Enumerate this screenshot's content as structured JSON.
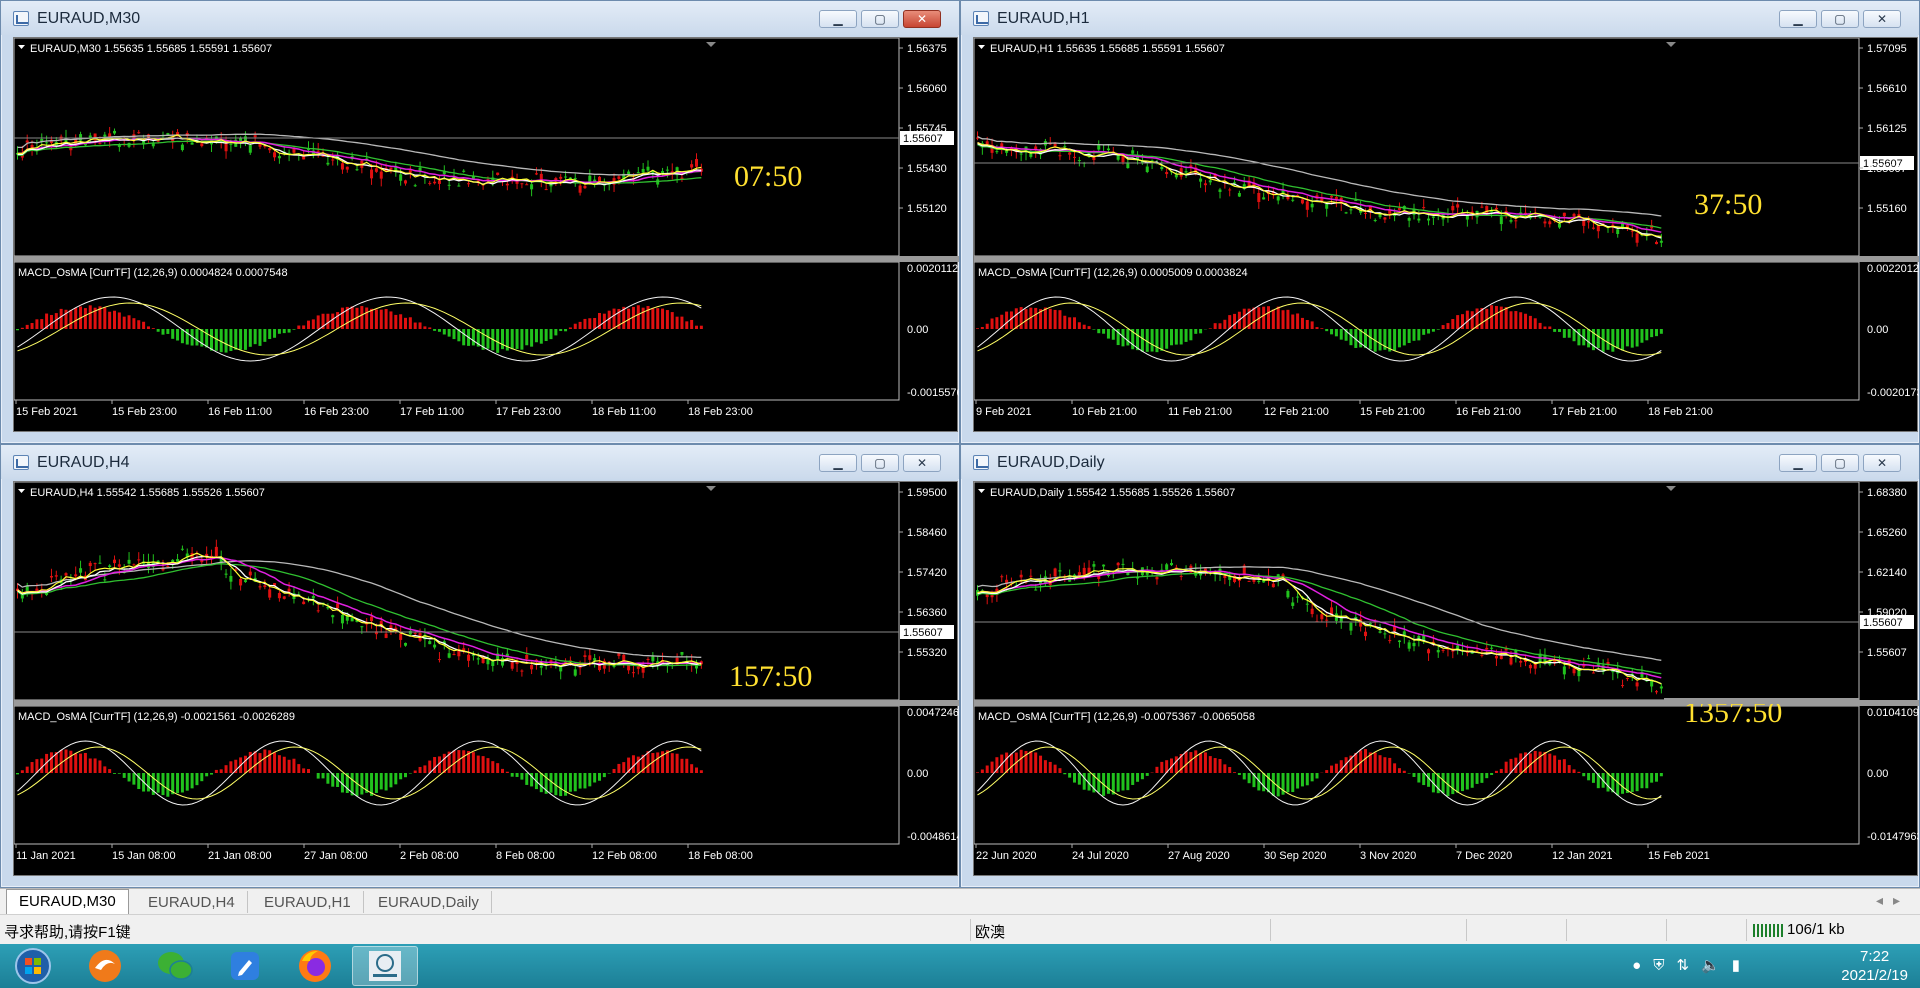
{
  "windows": [
    {
      "title": "EURAUD,M30",
      "header": "EURAUD,M30  1.55635 1.55685 1.55591 1.55607",
      "price_ticks": [
        "1.56375",
        "1.56060",
        "1.55745",
        "1.55430",
        "1.55120"
      ],
      "price_label": "1.55607",
      "timer": "07:50",
      "macd_header": "MACD_OsMA [CurrTF] (12,26,9) 0.0004824 0.0007548",
      "macd_ticks": [
        "0.0020112",
        "0.00",
        "-0.0015576"
      ],
      "x_labels": [
        "15 Feb 2021",
        "15 Feb 23:00",
        "16 Feb 11:00",
        "16 Feb 23:00",
        "17 Feb 11:00",
        "17 Feb 23:00",
        "18 Feb 11:00",
        "18 Feb 23:00"
      ],
      "active": true
    },
    {
      "title": "EURAUD,H1",
      "header": "EURAUD,H1  1.55635 1.55685 1.55591 1.55607",
      "price_ticks": [
        "1.57095",
        "1.56610",
        "1.56125",
        "1.55607",
        "1.55160"
      ],
      "price_label": "1.55607",
      "timer": "37:50",
      "macd_header": "MACD_OsMA [CurrTF] (12,26,9) 0.0005009 0.0003824",
      "macd_ticks": [
        "0.0022012",
        "0.00",
        "-0.0020173"
      ],
      "x_labels": [
        "9 Feb 2021",
        "10 Feb 21:00",
        "11 Feb 21:00",
        "12 Feb 21:00",
        "15 Feb 21:00",
        "16 Feb 21:00",
        "17 Feb 21:00",
        "18 Feb 21:00"
      ],
      "active": false
    },
    {
      "title": "EURAUD,H4",
      "header": "EURAUD,H4  1.55542 1.55685 1.55526 1.55607",
      "price_ticks": [
        "1.59500",
        "1.58460",
        "1.57420",
        "1.56360",
        "1.55320"
      ],
      "price_label": "1.55607",
      "timer": "157:50",
      "macd_header": "MACD_OsMA [CurrTF] (12,26,9) -0.0021561 -0.0026289",
      "macd_ticks": [
        "0.0047246",
        "0.00",
        "-0.0048614"
      ],
      "x_labels": [
        "11 Jan 2021",
        "15 Jan 08:00",
        "21 Jan 08:00",
        "27 Jan 08:00",
        "2 Feb 08:00",
        "8 Feb 08:00",
        "12 Feb 08:00",
        "18 Feb 08:00"
      ],
      "active": false
    },
    {
      "title": "EURAUD,Daily",
      "header": "EURAUD,Daily  1.55542 1.55685 1.55526 1.55607",
      "price_ticks": [
        "1.68380",
        "1.65260",
        "1.62140",
        "1.59020",
        "1.55607"
      ],
      "price_label": "1.55607",
      "timer": "1357:50",
      "macd_header": "MACD_OsMA [CurrTF] (12,26,9) -0.0075367 -0.0065058",
      "macd_ticks": [
        "0.0104109",
        "0.00",
        "-0.0147963"
      ],
      "x_labels": [
        "22 Jun 2020",
        "24 Jul 2020",
        "27 Aug 2020",
        "30 Sep 2020",
        "3 Nov 2020",
        "7 Dec 2020",
        "12 Jan 2021",
        "15 Feb 2021"
      ],
      "active": false
    }
  ],
  "tabs": [
    "EURAUD,M30",
    "EURAUD,H4",
    "EURAUD,H1",
    "EURAUD,Daily"
  ],
  "status": {
    "help": "寻求帮助,请按F1键",
    "profile": "欧澳",
    "traffic": "106/1 kb"
  },
  "clock": {
    "time": "7:22",
    "date": "2021/2/19"
  },
  "colors": {
    "bull": "#21c21d",
    "bear": "#e01010",
    "ma_fast": "#ffff33",
    "ma_white": "#ffffff",
    "ma_magenta": "#e020e0",
    "ma_green": "#30c030",
    "ma_gray": "#b8b8b8",
    "timer": "#ffe030"
  },
  "icons": {
    "start": "windows-orb-icon",
    "app1": "swirl-icon",
    "app2": "wechat-icon",
    "app3": "pen-icon",
    "app4": "firefox-icon",
    "app5": "mt4-icon"
  }
}
